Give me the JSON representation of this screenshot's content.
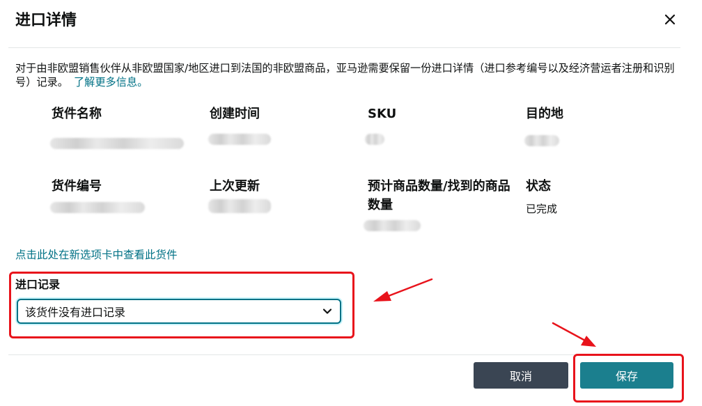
{
  "dialog": {
    "title": "进口详情",
    "close_icon": "close-icon"
  },
  "description": {
    "text": "对于由非欧盟销售伙伴从非欧盟国家/地区进口到法国的非欧盟商品，亚马逊需要保留一份进口详情（进口参考编号以及经济营运者注册和识别号）记录。",
    "link": "了解更多信息。"
  },
  "fields": {
    "shipment_name": {
      "label": "货件名称",
      "value": ""
    },
    "created_time": {
      "label": "创建时间",
      "value": ""
    },
    "sku": {
      "label": "SKU",
      "value": ""
    },
    "destination": {
      "label": "目的地",
      "value": ""
    },
    "shipment_id": {
      "label": "货件编号",
      "value": ""
    },
    "last_updated": {
      "label": "上次更新",
      "value": ""
    },
    "quantity": {
      "label": "预计商品数量/找到的商品数量",
      "value": ""
    },
    "status": {
      "label": "状态",
      "value": "已完成"
    }
  },
  "view_shipment_link": "点击此处在新选项卡中查看此货件",
  "import_record": {
    "label": "进口记录",
    "selected": "该货件没有进口记录"
  },
  "buttons": {
    "cancel": "取消",
    "save": "保存"
  },
  "colors": {
    "link": "#007185",
    "save_button": "#1b7f8e",
    "cancel_button": "#3a4553",
    "annotation_red": "#e8131b"
  }
}
